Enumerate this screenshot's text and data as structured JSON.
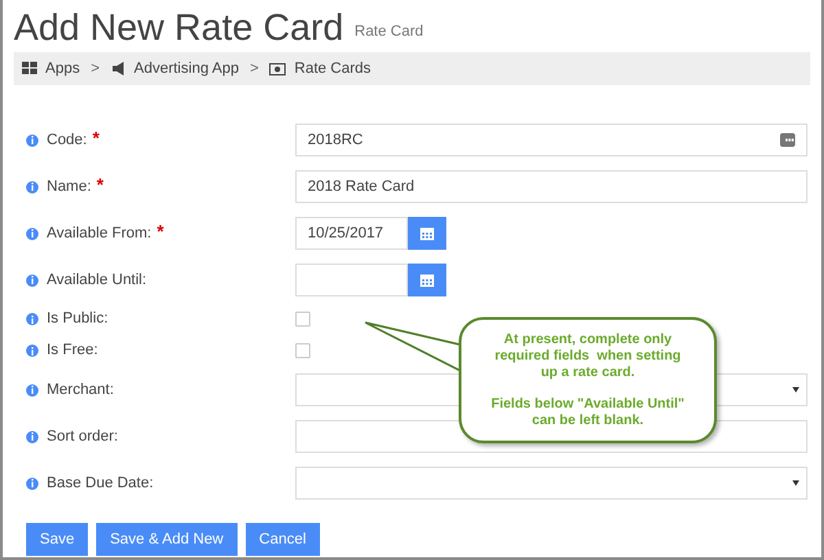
{
  "page": {
    "title": "Add New Rate Card",
    "subtitle": "Rate Card"
  },
  "breadcrumb": [
    {
      "label": "Apps"
    },
    {
      "separator": ">",
      "label": "Advertising App"
    },
    {
      "separator": ">",
      "label": "Rate Cards"
    }
  ],
  "fields": [
    {
      "label": "Code:",
      "required_mark": "*",
      "kind": "code",
      "value": "2018RC"
    },
    {
      "label": "Name:",
      "required_mark": "*",
      "kind": "text",
      "value": "2018 Rate Card"
    },
    {
      "label": "Available From:",
      "required_mark": "*",
      "kind": "date",
      "value": "10/25/2017"
    },
    {
      "label": "Available Until:",
      "kind": "date"
    },
    {
      "label": "Is Public:",
      "kind": "checkbox",
      "checked": false
    },
    {
      "label": "Is Free:",
      "kind": "checkbox",
      "checked": false
    },
    {
      "label": "Merchant:",
      "kind": "select"
    },
    {
      "label": "Sort order:",
      "kind": "text"
    },
    {
      "label": "Base Due Date:",
      "kind": "select"
    }
  ],
  "buttons": [
    "Save",
    "Save & Add New",
    "Cancel"
  ],
  "callout": {
    "lines": [
      "At present, complete only required fields  when setting up a rate card.",
      "Fields below \"Available Until\" can be left blank."
    ]
  }
}
